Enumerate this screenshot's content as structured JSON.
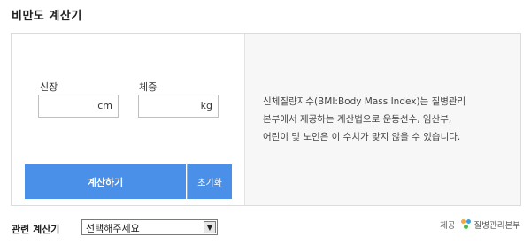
{
  "title": "비만도 계산기",
  "form": {
    "height_label": "신장",
    "height_value": "",
    "height_unit": "cm",
    "weight_label": "체중",
    "weight_value": "",
    "weight_unit": "kg",
    "calculate_label": "계산하기",
    "reset_label": "초기화"
  },
  "description": {
    "line1": "신체질량지수(BMI:Body Mass Index)는 질병관리",
    "line2": "본부에서 제공하는 계산법으로 운동선수, 임산부,",
    "line3": "어린이 및 노인은 이 수치가 맞지 않을 수 있습니다."
  },
  "related": {
    "label": "관련 계산기",
    "selected": "선택해주세요"
  },
  "provider": {
    "prefix": "제공",
    "name": "질병관리본부",
    "logo_icon": "kcdc-logo-icon"
  },
  "colors": {
    "button": "#4a8fe8",
    "info_bg": "#f7f7f7"
  }
}
